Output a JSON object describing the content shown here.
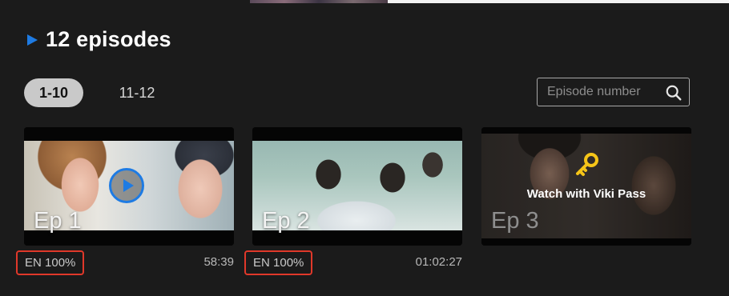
{
  "header": {
    "title": "12 episodes"
  },
  "tabs": [
    {
      "label": "1-10",
      "active": true
    },
    {
      "label": "11-12",
      "active": false
    }
  ],
  "search": {
    "placeholder": "Episode number",
    "icon": "search-icon"
  },
  "episodes": [
    {
      "label": "Ep 1",
      "subtitles": "EN 100%",
      "duration": "58:39",
      "locked": false,
      "show_play": true
    },
    {
      "label": "Ep 2",
      "subtitles": "EN 100%",
      "duration": "01:02:27",
      "locked": false,
      "show_play": false
    },
    {
      "label": "Ep 3",
      "locked": true,
      "lock_text": "Watch with Viki Pass",
      "icon": "key-icon"
    }
  ],
  "colors": {
    "accent": "#1e7be3",
    "highlight": "#e0382a",
    "key": "#f5c518",
    "background": "#1b1b1b"
  }
}
